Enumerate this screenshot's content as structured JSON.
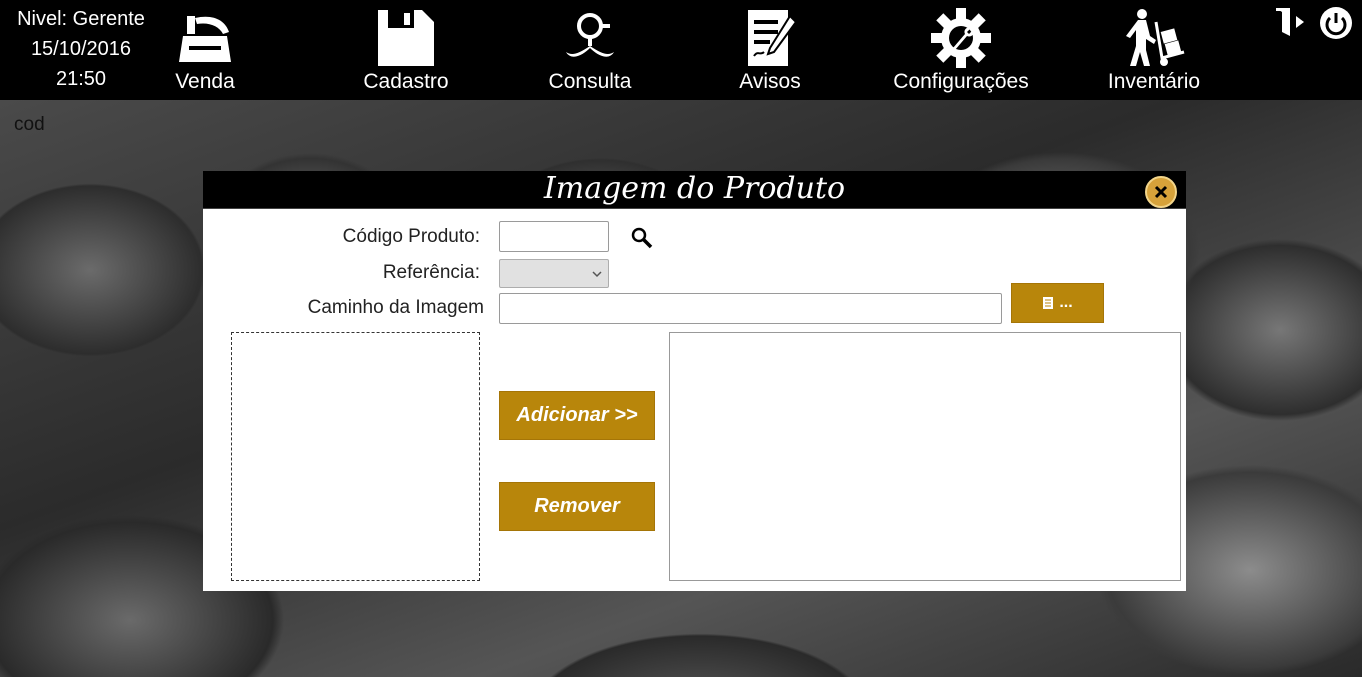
{
  "status": {
    "level": "Nivel: Gerente",
    "date": "15/10/2016",
    "time": "21:50"
  },
  "nav": {
    "items": [
      {
        "label": "Venda",
        "icon": "cash-register-icon"
      },
      {
        "label": "Cadastro",
        "icon": "save-disk-icon"
      },
      {
        "label": "Consulta",
        "icon": "magnifier-mustache-icon"
      },
      {
        "label": "Avisos",
        "icon": "notice-document-icon"
      },
      {
        "label": "Configurações",
        "icon": "gear-wrench-icon"
      },
      {
        "label": "Inventário",
        "icon": "hand-truck-icon"
      }
    ],
    "logout_icon": "logout-door-icon",
    "power_icon": "power-icon"
  },
  "background": {
    "cod_label": "cod"
  },
  "dialog": {
    "title": "Imagem do Produto",
    "close_icon": "close-icon",
    "fields": {
      "codigo_label": "Código Produto:",
      "codigo_value": "",
      "referencia_label": "Referência:",
      "referencia_value": "",
      "caminho_label": "Caminho da Imagem",
      "caminho_value": ""
    },
    "browse_label": "...",
    "add_label": "Adicionar >>",
    "remove_label": "Remover"
  },
  "colors": {
    "accent": "#b8860b",
    "close": "#d7a23a",
    "topbar": "#000000"
  }
}
